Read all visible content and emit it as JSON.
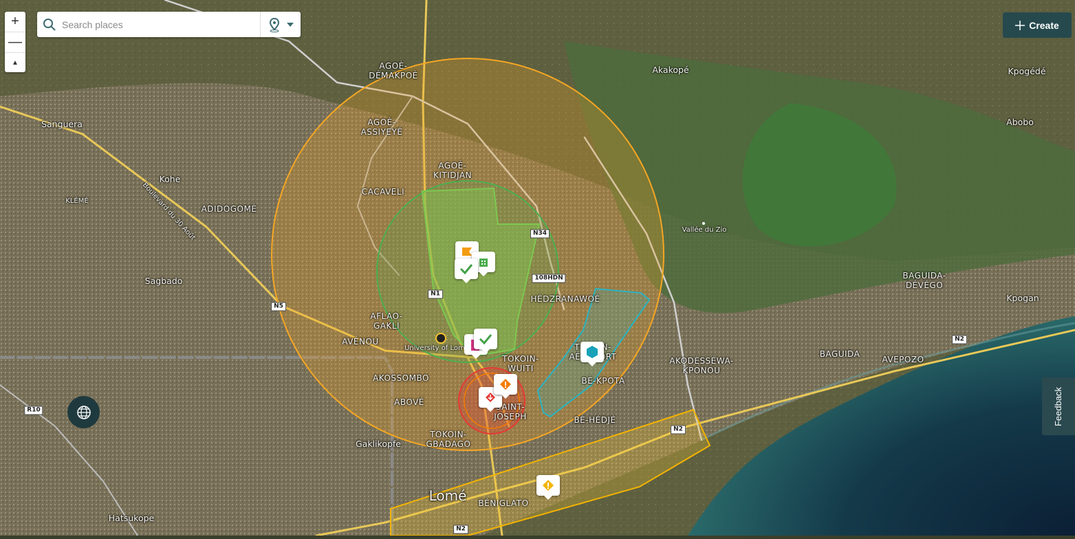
{
  "controls": {
    "zoom_in": "+",
    "zoom_out": "—",
    "compass": "▲"
  },
  "search": {
    "placeholder": "Search places",
    "icon": "search-icon",
    "location_icon": "location-pin-icon"
  },
  "create_button": {
    "label": "Create",
    "icon": "plus-icon"
  },
  "feedback_tab": {
    "label": "Feedback"
  },
  "globe_button": {
    "icon": "globe-icon"
  },
  "places": {
    "agoe_demakpoe": "AGOÈ-\nDÉMAKPOÈ",
    "agoe_assiyeye": "AGOÈ-\nASSIYEYÉ",
    "agoe_kitidjan": "AGOÈ-\nKITIDJAN",
    "cacaveli": "CACAVELI",
    "sanguera": "Sanguera",
    "kohe": "Kohe",
    "kleme": "KLÉMÉ",
    "adidogome": "ADIDOGOMÉ",
    "sagbado": "Sagbado",
    "boulevard": "Boulevard du 30 Août",
    "aflao_gakli": "AFLAO-\nGAKLI",
    "avenou": "AVÉNOU",
    "university": "University of Lomé",
    "tokoin_wuiti": "TOKOIN-\nWUITI",
    "akossombo": "AKOSSOMBO",
    "above": "ABOVÉ",
    "saint_joseph": "SAINT-\nJOSEPH",
    "tokoin_gbadago": "TOKOIN-\nGBADAGO",
    "gaklikopfe": "Gaklikopfe",
    "lome": "Lomé",
    "beniglato": "BÉNIGLATO",
    "hatsukope": "Hatsukope",
    "akakope": "Akakopé",
    "kpogede": "Kpogédé",
    "abobo": "Abobo",
    "vallee_du_zio": "Vallée du Zio",
    "hedzranawoe": "HÉDZRANAWOÉ",
    "tokoin_aeroport": "TOKOIN-\nAÉROPORT",
    "be_kpota": "BÈ-KPOTA",
    "be_hedje": "BÈ-HÉDJÉ",
    "akodessewa": "AKODÈSSÉWA-\nKPONOU",
    "baguida_devego": "BAGUIDA-\nDÉVÉGO",
    "kpogan": "Kpogan",
    "baguida": "BAGUIDA",
    "avepozo": "AVEPOZO"
  },
  "roads": {
    "n34": "N34",
    "n108": "108HDN",
    "n1": "N1",
    "n5": "N5",
    "r10": "R10",
    "n2a": "N2",
    "n2b": "N2",
    "n2c": "N2"
  },
  "markers": [
    {
      "name": "flag-marker",
      "icon": "flag-icon",
      "color": "#f39c12"
    },
    {
      "name": "building-marker",
      "icon": "building-icon",
      "color": "#4caf50"
    },
    {
      "name": "check-marker-1",
      "icon": "check-icon",
      "color": "#43a047"
    },
    {
      "name": "check-marker-2",
      "icon": "check-icon",
      "color": "#43a047"
    },
    {
      "name": "shape-marker",
      "icon": "shape-icon",
      "color": "#d63384"
    },
    {
      "name": "hexagon-marker",
      "icon": "hexagon-icon",
      "color": "#17a2b8"
    },
    {
      "name": "down-arrow-marker",
      "icon": "arrow-down-icon",
      "color": "#e53935"
    },
    {
      "name": "warning-orange-marker",
      "icon": "warning-icon",
      "color": "#f57c00"
    },
    {
      "name": "warning-yellow-marker",
      "icon": "warning-icon",
      "color": "#f4b400"
    }
  ],
  "colors": {
    "orange_zone": "#f5a623",
    "green_zone": "#4caf50",
    "red_zone": "#e53935",
    "cyan_zone": "#2bb3c0",
    "accent": "#26494e"
  }
}
